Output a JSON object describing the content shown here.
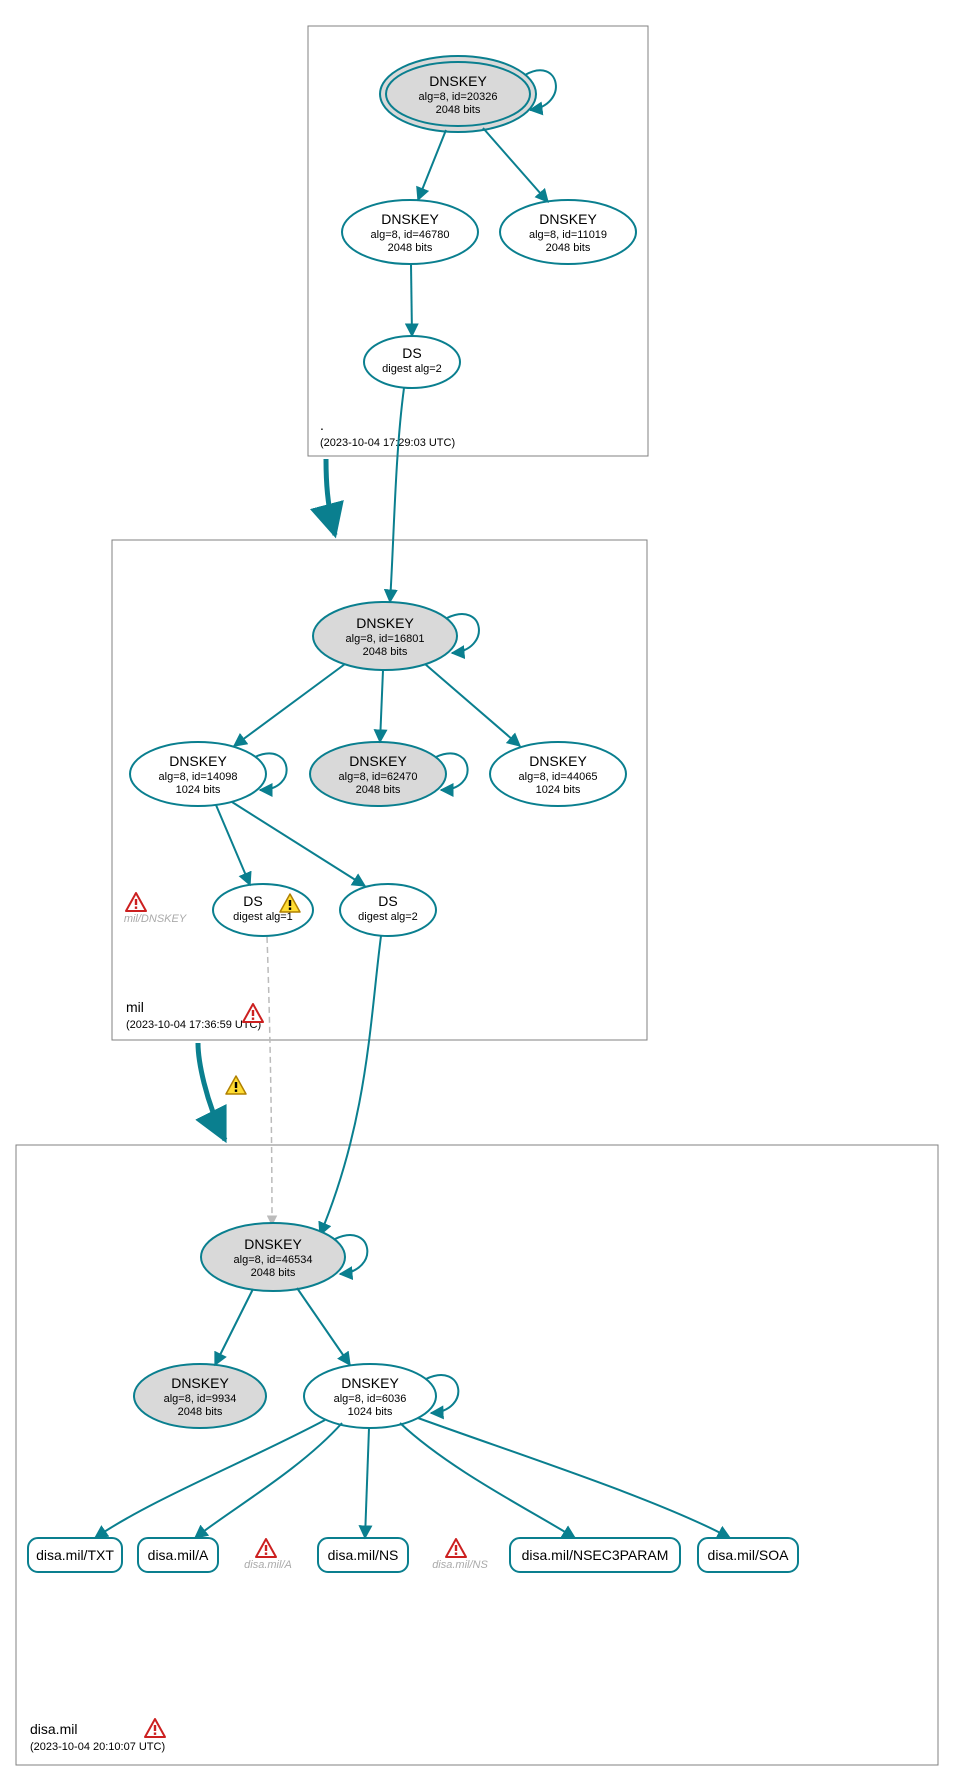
{
  "colors": {
    "stroke": "#0a7f8f",
    "nodeGray": "#d9d9d9",
    "nodeWhite": "#ffffff",
    "zoneBorder": "#808080"
  },
  "zones": {
    "root": {
      "name": ".",
      "timestamp": "(2023-10-04 17:29:03 UTC)"
    },
    "mil": {
      "name": "mil",
      "timestamp": "(2023-10-04 17:36:59 UTC)"
    },
    "disa": {
      "name": "disa.mil",
      "timestamp": "(2023-10-04 20:10:07 UTC)"
    }
  },
  "nodes": {
    "root_ksk": {
      "title": "DNSKEY",
      "line2": "alg=8, id=20326",
      "line3": "2048 bits"
    },
    "root_zsk1": {
      "title": "DNSKEY",
      "line2": "alg=8, id=46780",
      "line3": "2048 bits"
    },
    "root_zsk2": {
      "title": "DNSKEY",
      "line2": "alg=8, id=11019",
      "line3": "2048 bits"
    },
    "root_ds": {
      "title": "DS",
      "line2": "digest alg=2"
    },
    "mil_ksk": {
      "title": "DNSKEY",
      "line2": "alg=8, id=16801",
      "line3": "2048 bits"
    },
    "mil_zsk1": {
      "title": "DNSKEY",
      "line2": "alg=8, id=14098",
      "line3": "1024 bits"
    },
    "mil_zsk2": {
      "title": "DNSKEY",
      "line2": "alg=8, id=62470",
      "line3": "2048 bits"
    },
    "mil_zsk3": {
      "title": "DNSKEY",
      "line2": "alg=8, id=44065",
      "line3": "1024 bits"
    },
    "mil_ds1": {
      "title": "DS",
      "line2": "digest alg=1"
    },
    "mil_ds2": {
      "title": "DS",
      "line2": "digest alg=2"
    },
    "disa_ksk": {
      "title": "DNSKEY",
      "line2": "alg=8, id=46534",
      "line3": "2048 bits"
    },
    "disa_zsk1": {
      "title": "DNSKEY",
      "line2": "alg=8, id=9934",
      "line3": "2048 bits"
    },
    "disa_zsk2": {
      "title": "DNSKEY",
      "line2": "alg=8, id=6036",
      "line3": "1024 bits"
    },
    "rr_txt": {
      "label": "disa.mil/TXT"
    },
    "rr_a": {
      "label": "disa.mil/A"
    },
    "rr_ns": {
      "label": "disa.mil/NS"
    },
    "rr_nsec3": {
      "label": "disa.mil/NSEC3PARAM"
    },
    "rr_soa": {
      "label": "disa.mil/SOA"
    }
  },
  "ghosts": {
    "mil_dnskey": "mil/DNSKEY",
    "disa_a": "disa.mil/A",
    "disa_ns": "disa.mil/NS"
  },
  "icons": {
    "warning_yellow": "warning-icon",
    "warning_red": "error-icon"
  }
}
